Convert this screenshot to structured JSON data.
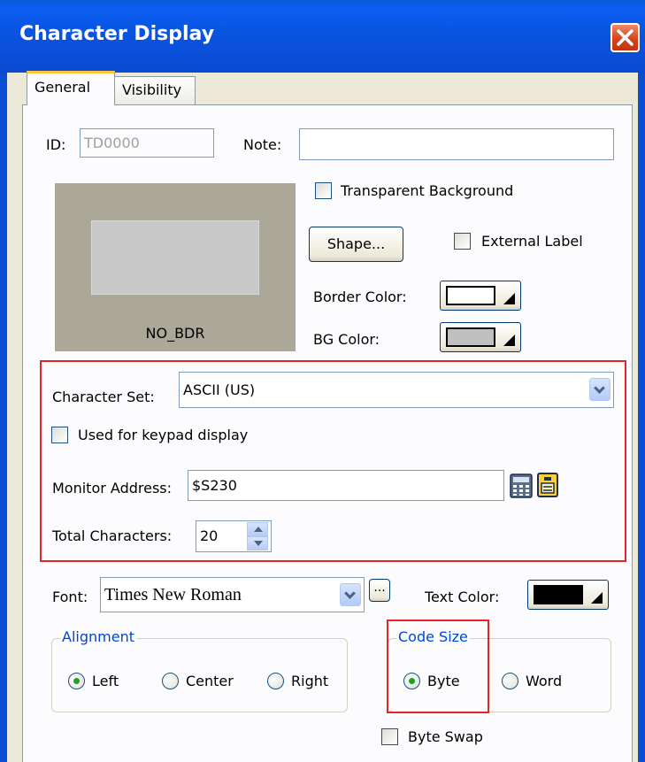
{
  "window": {
    "title": "Character Display"
  },
  "tabs": [
    {
      "label": "General"
    },
    {
      "label": "Visibility"
    }
  ],
  "general": {
    "id_label": "ID:",
    "id_value": "TD0000",
    "note_label": "Note:",
    "note_value": "",
    "transparent_bg_label": "Transparent Background",
    "shape_button": "Shape...",
    "external_label_label": "External Label",
    "border_color_label": "Border Color:",
    "border_color": "#ffffff",
    "bg_color_label": "BG Color:",
    "bg_color": "#c0c0c0",
    "preview_label": "NO_BDR",
    "character_set_label": "Character Set:",
    "character_set_value": "ASCII (US)",
    "keypad_label": "Used for keypad display",
    "monitor_address_label": "Monitor Address:",
    "monitor_address_value": "$S230",
    "total_characters_label": "Total Characters:",
    "total_characters_value": "20",
    "font_label": "Font:",
    "font_value": "Times New Roman",
    "font_browse_button": "...",
    "text_color_label": "Text Color:",
    "text_color": "#000000",
    "alignment": {
      "title": "Alignment",
      "options": [
        "Left",
        "Center",
        "Right"
      ],
      "selected": "Left"
    },
    "code_size": {
      "title": "Code Size",
      "options": [
        "Byte",
        "Word"
      ],
      "selected": "Byte"
    },
    "byte_swap_label": "Byte Swap"
  },
  "colors": {
    "highlight_box": "#e0262c",
    "titlebar": "#0a55e3",
    "group_title": "#0046d5"
  }
}
